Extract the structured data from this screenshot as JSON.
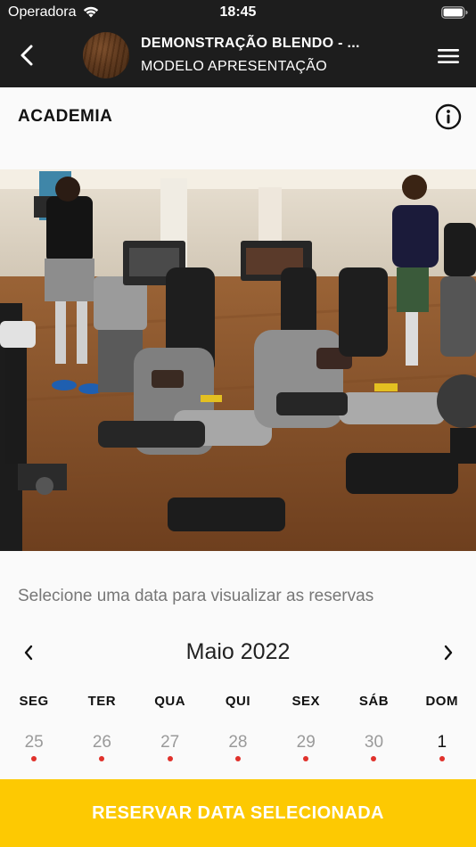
{
  "status_bar": {
    "carrier": "Operadora",
    "time": "18:45"
  },
  "nav": {
    "title": "DEMONSTRAÇÃO BLENDO - ...",
    "subtitle": "MODELO APRESENTAÇÃO"
  },
  "section": {
    "title": "ACADEMIA"
  },
  "instruction": "Selecione uma data para visualizar as reservas",
  "calendar": {
    "month_label": "Maio 2022",
    "weekdays": [
      "SEG",
      "TER",
      "QUA",
      "QUI",
      "SEX",
      "SÁB",
      "DOM"
    ],
    "days": [
      {
        "label": "25",
        "in_month": false,
        "has_event": true
      },
      {
        "label": "26",
        "in_month": false,
        "has_event": true
      },
      {
        "label": "27",
        "in_month": false,
        "has_event": true
      },
      {
        "label": "28",
        "in_month": false,
        "has_event": true
      },
      {
        "label": "29",
        "in_month": false,
        "has_event": true
      },
      {
        "label": "30",
        "in_month": false,
        "has_event": true
      },
      {
        "label": "1",
        "in_month": true,
        "has_event": true
      }
    ]
  },
  "reserve_button": {
    "label": "RESERVAR DATA SELECIONADA"
  },
  "colors": {
    "nav_bg": "#1d1d1d",
    "accent": "#fdc902",
    "event_dot": "#e0312b",
    "muted_day": "#9a9a9a"
  }
}
